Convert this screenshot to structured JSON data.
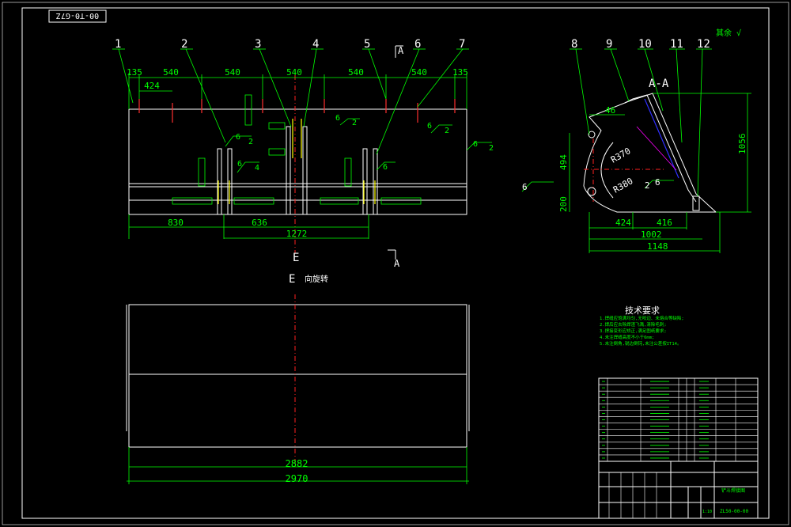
{
  "stamp": "00-T0-G7Z",
  "roughness_mark": "其余 √",
  "parts": [
    "1",
    "2",
    "3",
    "4",
    "5",
    "6",
    "7",
    "8",
    "9",
    "10",
    "11",
    "12"
  ],
  "front": {
    "top_dims": [
      "135",
      "540",
      "540",
      "540",
      "540",
      "540",
      "135"
    ],
    "dim_424": "424",
    "bottom_dims": [
      "830",
      "636",
      "1272"
    ],
    "section_left_letter": "A",
    "section_right_letter": "A",
    "view_letter": "E",
    "weld_labels": [
      "6",
      "2",
      "6",
      "4",
      "6",
      "2",
      "6",
      "2",
      "6",
      "2",
      "6",
      "6",
      "2"
    ]
  },
  "bottom_view": {
    "title_letter": "E",
    "title_text": "向旋转",
    "dims": [
      "2882",
      "2970"
    ]
  },
  "section": {
    "title": "A-A",
    "dims": [
      "46",
      "494",
      "200",
      "424",
      "416",
      "1002",
      "1148",
      "1056"
    ],
    "radii": [
      "R370",
      "R380"
    ],
    "weld": [
      "6",
      "2",
      "6"
    ]
  },
  "tech": {
    "title": "技术要求",
    "lines": [
      "1.焊缝应饱满均匀,无咬边、未熔合等缺陷;",
      "2.焊后应去除焊渣飞溅,清除毛刺;",
      "3.焊接变形应矫正,满足图纸要求;",
      "4.未注焊缝高度不小于6mm;",
      "5.未注倒角,锐边倒钝,未注公差按IT14。"
    ]
  },
  "title_block": {
    "drawing_name": "铲斗焊接图",
    "drawing_no": "ZL50-00-00",
    "scale": "1:10"
  }
}
